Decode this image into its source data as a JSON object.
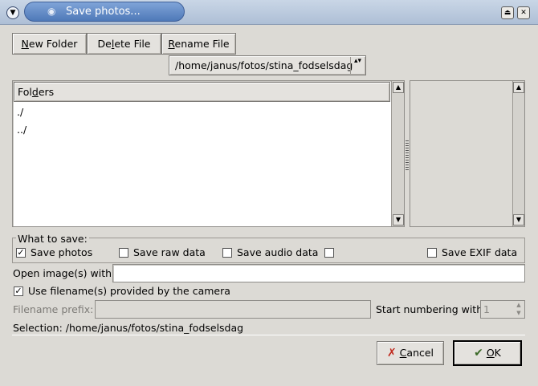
{
  "window": {
    "title": "Save photos...",
    "menu_glyph": "▼",
    "shade_glyph": "⏏",
    "close_glyph": "✕"
  },
  "toolbar": {
    "new_folder_pre": "",
    "new_folder_key": "N",
    "new_folder_post": "ew Folder",
    "delete_file_pre": "De",
    "delete_file_key": "l",
    "delete_file_post": "ete File",
    "rename_file_pre": "",
    "rename_file_key": "R",
    "rename_file_post": "ename File"
  },
  "path_combo": {
    "value": "/home/janus/fotos/stina_fodselsdag",
    "arrows": "▴▾"
  },
  "folders": {
    "header_pre": "Fol",
    "header_key": "d",
    "header_post": "ers",
    "items": [
      "./",
      "../"
    ]
  },
  "what_to_save": {
    "legend": "What to save:",
    "save_photos": {
      "label": "Save photos",
      "checked": true
    },
    "save_raw": {
      "label": "Save raw data",
      "checked": false
    },
    "save_audio": {
      "label": "Save audio data",
      "checked": false
    },
    "unnamed": {
      "label": "",
      "checked": false
    },
    "save_exif": {
      "label": "Save EXIF data",
      "checked": false
    }
  },
  "open_images": {
    "label": "Open image(s) with:",
    "value": ""
  },
  "use_filenames": {
    "label": "Use filename(s) provided by the camera",
    "checked": true
  },
  "filename_prefix": {
    "label": "Filename prefix:",
    "value": ""
  },
  "start_numbering": {
    "label": "Start numbering with:",
    "value": "1"
  },
  "selection": {
    "text": "Selection: /home/janus/fotos/stina_fodselsdag"
  },
  "actions": {
    "cancel_key": "C",
    "cancel_post": "ancel",
    "ok_key": "O",
    "ok_post": "K",
    "cancel_icon_color": "#c0281c",
    "ok_icon_color": "#3d6b2a"
  },
  "icons": {
    "camera": "camera-icon",
    "check": "✓",
    "up": "▲",
    "down": "▼",
    "cancel": "✗",
    "ok": "✔"
  }
}
